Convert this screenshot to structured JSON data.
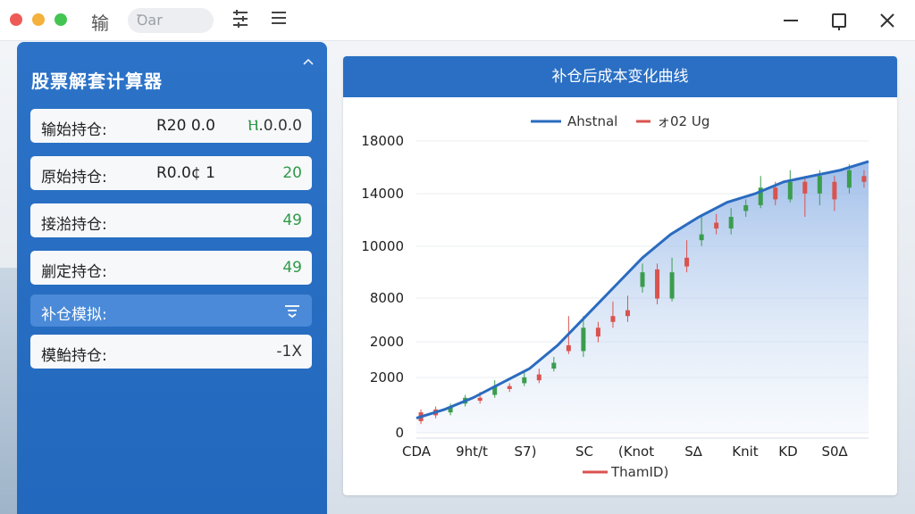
{
  "titlebar": {
    "app_glyph": "输",
    "search_text": "Ꝺar",
    "filter_icon": "filter-icon",
    "menu_icon": "hamburger-menu-icon"
  },
  "panel": {
    "title": "股票解套计算器",
    "rows": [
      {
        "label": "输始持仓:",
        "mid": "R20 0.0",
        "value": "Ⲏ.0.0.0",
        "value_color": "dark"
      },
      {
        "label": "原始持仓:",
        "mid": "R0.0¢ 1",
        "value": "20"
      },
      {
        "label": "接湁持仓:",
        "mid": "",
        "value": "49"
      },
      {
        "label": "剻定持仓:",
        "mid": "",
        "value": "49"
      }
    ],
    "sim_label": "补仓模拟:",
    "last_row": {
      "label": "模鲐持仓:",
      "value": "-1X"
    }
  },
  "chart": {
    "header": "补仓后成本变化曲线",
    "legend": [
      {
        "name": "Ahstnal",
        "color": "#2a6bbf"
      },
      {
        "name": "ォ02 Ug",
        "color": "#d9534f"
      }
    ],
    "bottom_legend": {
      "name": "ThamID)",
      "color": "#d9534f"
    }
  },
  "chart_data": {
    "type": "line",
    "yticks": [
      "18000",
      "14000",
      "10000",
      "8000",
      "2000",
      "2000",
      "0"
    ],
    "xticks": [
      "CDA",
      "9ht/t",
      "S7)",
      "SC",
      "(Knot",
      "S∆",
      "Knit",
      "KD",
      "S0∆"
    ],
    "line_series": [
      0.05,
      0.08,
      0.12,
      0.17,
      0.22,
      0.3,
      0.4,
      0.5,
      0.6,
      0.68,
      0.74,
      0.79,
      0.82,
      0.86,
      0.88,
      0.9,
      0.93
    ],
    "candles": [
      [
        0.07,
        0.04,
        0.08,
        0.03
      ],
      [
        0.08,
        0.06,
        0.09,
        0.05
      ],
      [
        0.07,
        0.09,
        0.1,
        0.06
      ],
      [
        0.1,
        0.12,
        0.13,
        0.09
      ],
      [
        0.12,
        0.11,
        0.14,
        0.1
      ],
      [
        0.13,
        0.16,
        0.18,
        0.12
      ],
      [
        0.16,
        0.15,
        0.17,
        0.14
      ],
      [
        0.17,
        0.19,
        0.21,
        0.16
      ],
      [
        0.2,
        0.18,
        0.22,
        0.17
      ],
      [
        0.22,
        0.24,
        0.26,
        0.21
      ],
      [
        0.3,
        0.28,
        0.4,
        0.27
      ],
      [
        0.28,
        0.36,
        0.4,
        0.26
      ],
      [
        0.36,
        0.33,
        0.38,
        0.31
      ],
      [
        0.4,
        0.38,
        0.45,
        0.36
      ],
      [
        0.42,
        0.4,
        0.47,
        0.38
      ],
      [
        0.5,
        0.55,
        0.58,
        0.48
      ],
      [
        0.56,
        0.46,
        0.58,
        0.44
      ],
      [
        0.46,
        0.55,
        0.6,
        0.45
      ],
      [
        0.6,
        0.57,
        0.66,
        0.55
      ],
      [
        0.66,
        0.68,
        0.74,
        0.64
      ],
      [
        0.72,
        0.7,
        0.75,
        0.68
      ],
      [
        0.7,
        0.74,
        0.77,
        0.68
      ],
      [
        0.76,
        0.78,
        0.8,
        0.74
      ],
      [
        0.78,
        0.84,
        0.88,
        0.77
      ],
      [
        0.84,
        0.8,
        0.86,
        0.78
      ],
      [
        0.8,
        0.86,
        0.9,
        0.79
      ],
      [
        0.86,
        0.82,
        0.88,
        0.74
      ],
      [
        0.82,
        0.88,
        0.9,
        0.78
      ],
      [
        0.86,
        0.8,
        0.88,
        0.76
      ],
      [
        0.84,
        0.9,
        0.92,
        0.82
      ],
      [
        0.88,
        0.86,
        0.9,
        0.84
      ]
    ]
  }
}
